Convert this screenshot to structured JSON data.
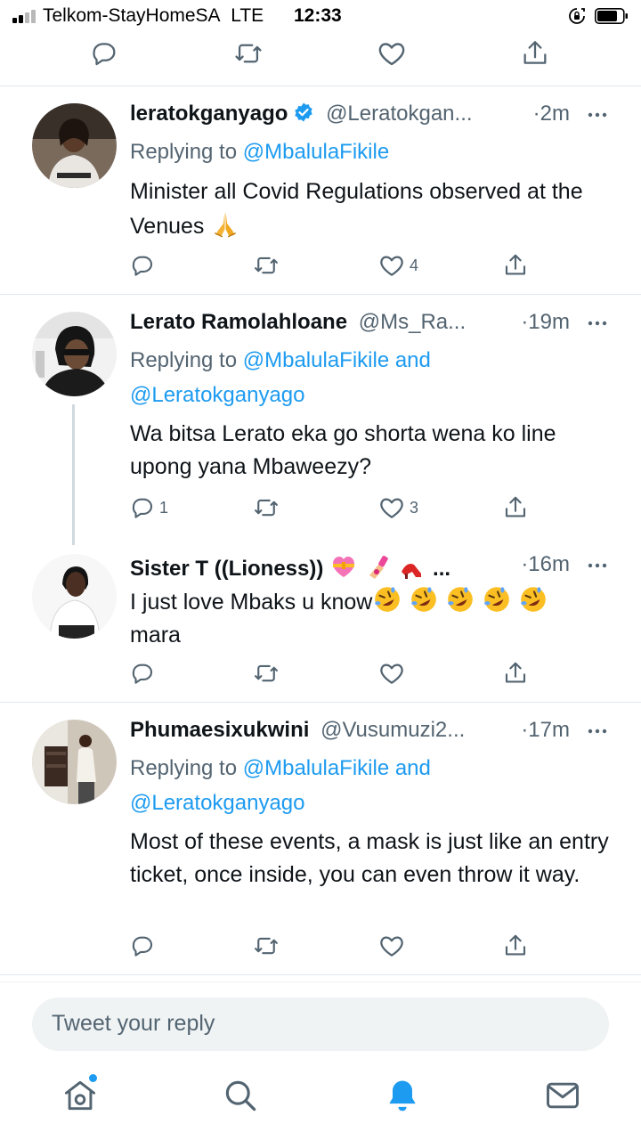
{
  "status_bar": {
    "carrier": "Telkom-StayHomeSA",
    "network": "LTE",
    "time": "12:33"
  },
  "colors": {
    "accent": "#1d9bf0",
    "text": "#0f1419",
    "secondary": "#536471",
    "divider": "#e1e8ed"
  },
  "tweets": [
    {
      "name": "leratokganyago",
      "verified": true,
      "handle": "@Leratokgan...",
      "time": "·2m",
      "replying_prefix": "Replying to ",
      "replying_mentions": "@MbalulaFikile",
      "text": "Minister all Covid Regulations observed at the Venues",
      "emoji": "folded-hands",
      "actions": {
        "reply": "",
        "retweet": "",
        "like": "4"
      }
    },
    {
      "name": "Lerato Ramolahloane",
      "verified": false,
      "handle": "@Ms_Ra...",
      "time": "·19m",
      "replying_prefix": "Replying to ",
      "replying_mentions": "@MbalulaFikile and",
      "replying_mentions_2": "@Leratokganyago",
      "text": "Wa bitsa Lerato eka go shorta wena ko line upong yana Mbaweezy?",
      "actions": {
        "reply": "1",
        "retweet": "",
        "like": "3"
      }
    },
    {
      "name": "Sister T ((Lioness))",
      "name_emoji": [
        "heart-with-ribbon",
        "nail-polish",
        "high-heel"
      ],
      "name_suffix": "...",
      "verified": false,
      "handle": "",
      "time": "·16m",
      "text_line1": "I just love Mbaks u know",
      "text_emoji": [
        "rolling-laughing",
        "rolling-laughing",
        "rolling-laughing",
        "rolling-laughing",
        "rolling-laughing"
      ],
      "text_line2": "mara",
      "actions": {
        "reply": "",
        "retweet": "",
        "like": ""
      }
    },
    {
      "name": "Phumaesixukwini",
      "verified": false,
      "handle": "@Vusumuzi2...",
      "time": "·17m",
      "replying_prefix": "Replying to ",
      "replying_mentions": "@MbalulaFikile and",
      "replying_mentions_2": "@Leratokganyago",
      "text": "Most of these events, a mask is just like an entry ticket, once inside, you can even throw it way.",
      "actions": {
        "reply": "",
        "retweet": "",
        "like": ""
      }
    }
  ],
  "reply_bar": {
    "placeholder": "Tweet your reply"
  },
  "bottom_nav": [
    "home-icon",
    "search-icon",
    "notifications-bell-icon",
    "messages-envelope-icon"
  ]
}
